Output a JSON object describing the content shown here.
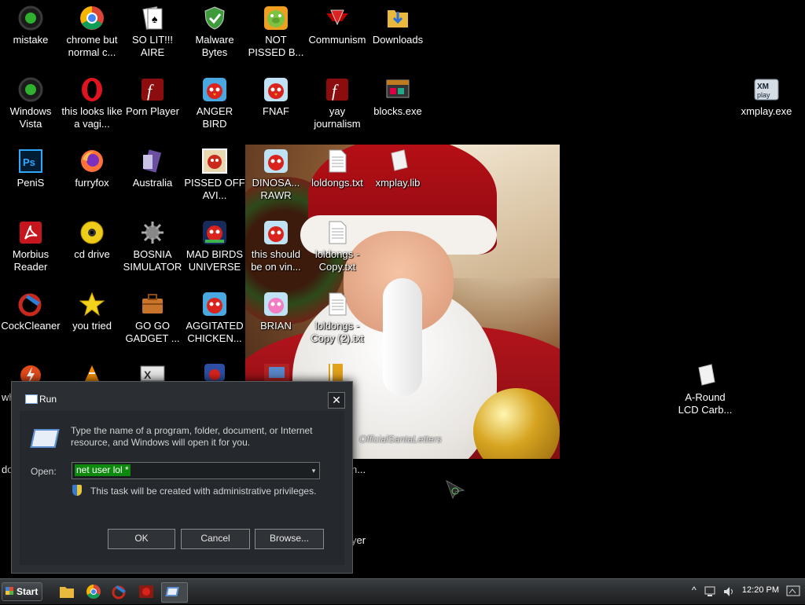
{
  "desktop": {
    "icons": [
      {
        "label": "mistake"
      },
      {
        "label": "chrome but normal c..."
      },
      {
        "label": "SO LIT!!! AIRE"
      },
      {
        "label": "Malware Bytes"
      },
      {
        "label": "NOT PISSED B..."
      },
      {
        "label": "Communism"
      },
      {
        "label": "Downloads"
      },
      {
        "label": "Windows Vista"
      },
      {
        "label": "this looks like a vagi..."
      },
      {
        "label": "Porn Player"
      },
      {
        "label": "ANGER BIRD"
      },
      {
        "label": "FNAF"
      },
      {
        "label": "yay journalism"
      },
      {
        "label": "blocks.exe"
      },
      {
        "label": "xmplay.exe"
      },
      {
        "label": "PeniS"
      },
      {
        "label": "furryfox"
      },
      {
        "label": "Australia"
      },
      {
        "label": "PISSED OFF AVI..."
      },
      {
        "label": "DINOSA... RAWR"
      },
      {
        "label": "loldongs.txt"
      },
      {
        "label": "xmplay.lib"
      },
      {
        "label": "Morbius Reader"
      },
      {
        "label": "cd drive"
      },
      {
        "label": "BOSNIA SIMULATOR"
      },
      {
        "label": "MAD BIRDS UNIVERSE"
      },
      {
        "label": "this should be on vin..."
      },
      {
        "label": "loldongs - Copy.txt"
      },
      {
        "label": "CockCleaner"
      },
      {
        "label": "you tried"
      },
      {
        "label": "GO GO GADGET ..."
      },
      {
        "label": "AGGITATED CHICKEN..."
      },
      {
        "label": "BRIAN"
      },
      {
        "label": "loldongs - Copy (2).txt"
      },
      {
        "label": "A-Round LCD Carb..."
      }
    ],
    "partial_texts": [
      "wh",
      "do",
      "n...",
      "yer"
    ],
    "wallpaper_watermark": "OfficialSantaLetters"
  },
  "run_dialog": {
    "title": "Run",
    "close_glyph": "✕",
    "description": "Type the name of a program, folder, document, or Internet resource, and Windows will open it for you.",
    "open_label": "Open:",
    "open_value": "net user lol *",
    "dropdown_glyph": "▾",
    "admin_note": "This task will be created with administrative privileges.",
    "buttons": {
      "ok": "OK",
      "cancel": "Cancel",
      "browse": "Browse..."
    }
  },
  "taskbar": {
    "start_label": "Start",
    "pinned": [
      "explorer-icon",
      "chrome-icon",
      "ccleaner-icon",
      "game-icon",
      "run-icon"
    ],
    "tray": {
      "expand_glyph": "^",
      "clock": "12:20 PM"
    }
  }
}
